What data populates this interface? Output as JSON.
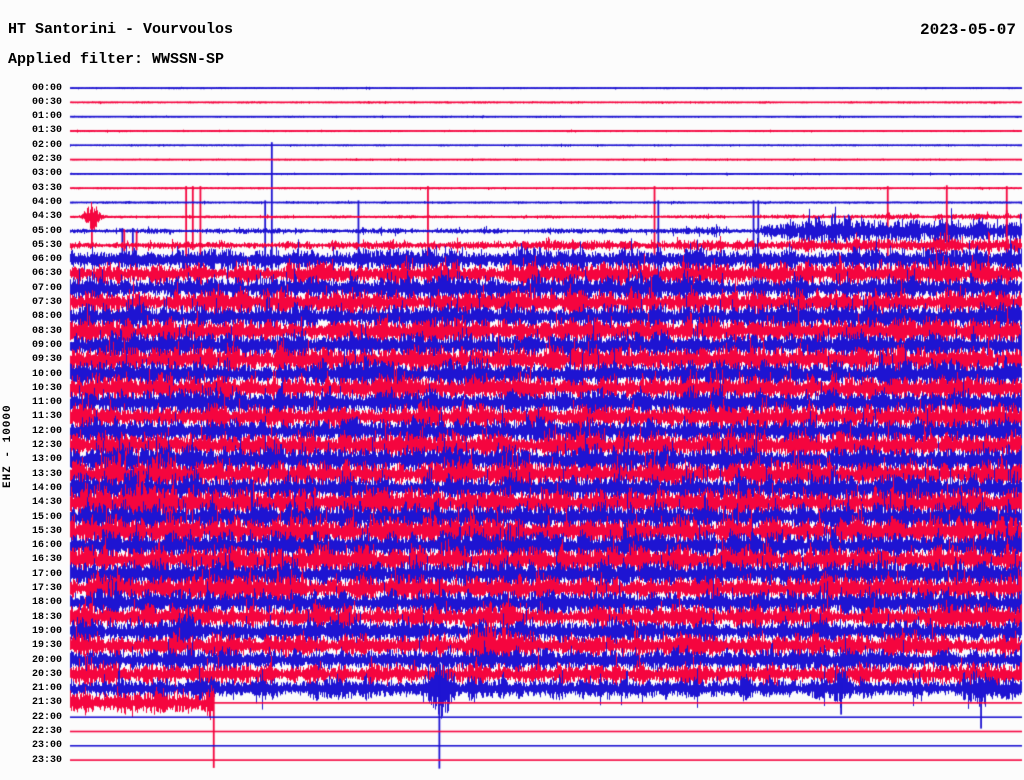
{
  "chart_data": {
    "type": "line",
    "subtype": "helicorder-seismogram",
    "title": "HT Santorini - Vourvoulos",
    "filter_label": "Applied filter: WWSSN-SP",
    "date": "2023-05-07",
    "ylabel": "EHZ - 10000",
    "row_interval_minutes": 30,
    "time_range": [
      "00:00",
      "23:30"
    ],
    "grid": false,
    "legend": "none",
    "colors": {
      "trace_even": "#1e14d2",
      "trace_odd": "#f5053f",
      "text": "#000000",
      "background": "#fcfcfc"
    },
    "rows": [
      {
        "t": "00:00",
        "a": 0.45
      },
      {
        "t": "00:30",
        "a": 0.45
      },
      {
        "t": "01:00",
        "a": 0.45
      },
      {
        "t": "01:30",
        "a": 0.45
      },
      {
        "t": "02:00",
        "a": 0.45,
        "spikes": [
          [
            0.212,
            3,
            160
          ]
        ]
      },
      {
        "t": "02:30",
        "a": 0.45
      },
      {
        "t": "03:00",
        "a": 0.45
      },
      {
        "t": "03:30",
        "a": 0.5,
        "spikes": [
          [
            0.122,
            2,
            85
          ],
          [
            0.129,
            2,
            62
          ],
          [
            0.137,
            2,
            100
          ],
          [
            0.376,
            2,
            95
          ],
          [
            0.614,
            2,
            140
          ],
          [
            0.859,
            2,
            112
          ],
          [
            0.984,
            2,
            92
          ]
        ]
      },
      {
        "t": "04:00",
        "a": 0.6,
        "spikes": [
          [
            0.205,
            2,
            75
          ],
          [
            0.303,
            2,
            55
          ],
          [
            0.618,
            2,
            130
          ],
          [
            0.718,
            2,
            98
          ],
          [
            0.723,
            2,
            106
          ]
        ]
      },
      {
        "t": "04:30",
        "env": [
          [
            0,
            0.8
          ],
          [
            0.55,
            0.9
          ],
          [
            0.8,
            1.5
          ],
          [
            1,
            2.2
          ]
        ],
        "bursts": [
          [
            0.023,
            0.008,
            9
          ]
        ],
        "spikes": [
          [
            0.023,
            6,
            28
          ]
        ]
      },
      {
        "t": "05:00",
        "env": [
          [
            0,
            1.6
          ],
          [
            0.55,
            1.8
          ],
          [
            0.72,
            2.5
          ],
          [
            0.76,
            8
          ],
          [
            0.81,
            11
          ],
          [
            0.86,
            7.5
          ],
          [
            0.92,
            9
          ],
          [
            1,
            8
          ]
        ],
        "spikes": [
          [
            0.055,
            3,
            28
          ],
          [
            0.066,
            3,
            24
          ],
          [
            0.93,
            4,
            55
          ]
        ]
      },
      {
        "t": "05:30",
        "env": [
          [
            0,
            2.2
          ],
          [
            0.4,
            2.8
          ],
          [
            0.7,
            3.5
          ],
          [
            0.85,
            4.5
          ],
          [
            1,
            5
          ]
        ],
        "spikes": [
          [
            0.057,
            16,
            6
          ],
          [
            0.07,
            14,
            5
          ],
          [
            0.921,
            60,
            255
          ],
          [
            0.984,
            35,
            60
          ]
        ]
      },
      {
        "t": "06:00",
        "env": [
          [
            0,
            6
          ],
          [
            0.3,
            7.5
          ],
          [
            0.7,
            8
          ],
          [
            1,
            8.5
          ]
        ]
      },
      {
        "t": "06:30",
        "env": [
          [
            0,
            6.5
          ],
          [
            0.5,
            8
          ],
          [
            1,
            8.5
          ]
        ]
      },
      {
        "t": "07:00",
        "a": 8
      },
      {
        "t": "07:30",
        "a": 8.2
      },
      {
        "t": "08:00",
        "a": 8.4
      },
      {
        "t": "08:30",
        "a": 8.8
      },
      {
        "t": "09:00",
        "a": 8.8
      },
      {
        "t": "09:30",
        "a": 8.8
      },
      {
        "t": "10:00",
        "a": 9
      },
      {
        "t": "10:30",
        "a": 8.8
      },
      {
        "t": "11:00",
        "a": 8.8
      },
      {
        "t": "11:30",
        "a": 8.8
      },
      {
        "t": "12:00",
        "a": 9
      },
      {
        "t": "12:30",
        "a": 9
      },
      {
        "t": "13:00",
        "a": 9.2,
        "bursts": [
          [
            0.06,
            0.03,
            3
          ]
        ]
      },
      {
        "t": "13:30",
        "a": 9.2,
        "bursts": [
          [
            0.07,
            0.04,
            4
          ]
        ]
      },
      {
        "t": "14:00",
        "a": 9.4,
        "bursts": [
          [
            0.07,
            0.04,
            4
          ]
        ]
      },
      {
        "t": "14:30",
        "a": 9.6,
        "bursts": [
          [
            0.08,
            0.05,
            4
          ]
        ]
      },
      {
        "t": "15:00",
        "a": 9.6
      },
      {
        "t": "15:30",
        "a": 9.6
      },
      {
        "t": "16:00",
        "a": 9.4
      },
      {
        "t": "16:30",
        "a": 9.4
      },
      {
        "t": "17:00",
        "a": 9
      },
      {
        "t": "17:30",
        "a": 8.8
      },
      {
        "t": "18:00",
        "a": 8.4
      },
      {
        "t": "18:30",
        "a": 8.4
      },
      {
        "t": "19:00",
        "a": 8,
        "bursts": [
          [
            0.117,
            0.012,
            11
          ]
        ]
      },
      {
        "t": "19:30",
        "a": 7.6,
        "bursts": [
          [
            0.442,
            0.02,
            13
          ]
        ]
      },
      {
        "t": "20:00",
        "a": 7.6
      },
      {
        "t": "20:30",
        "a": 7.2
      },
      {
        "t": "21:00",
        "a": 7,
        "bursts": [
          [
            0.39,
            0.01,
            17
          ],
          [
            0.81,
            0.008,
            8
          ],
          [
            0.957,
            0.008,
            9
          ]
        ],
        "spikes": [
          [
            0.388,
            28,
            80
          ],
          [
            0.81,
            6,
            26
          ],
          [
            0.957,
            8,
            40
          ]
        ]
      },
      {
        "t": "21:30",
        "a": 7,
        "end": 0.151,
        "bursts": [
          [
            0.148,
            0.006,
            7
          ]
        ],
        "spikes": [
          [
            0.151,
            10,
            65
          ]
        ]
      },
      {
        "t": "22:00",
        "a": 0
      },
      {
        "t": "22:30",
        "a": 0
      },
      {
        "t": "23:00",
        "a": 0
      },
      {
        "t": "23:30",
        "a": 0
      }
    ]
  }
}
